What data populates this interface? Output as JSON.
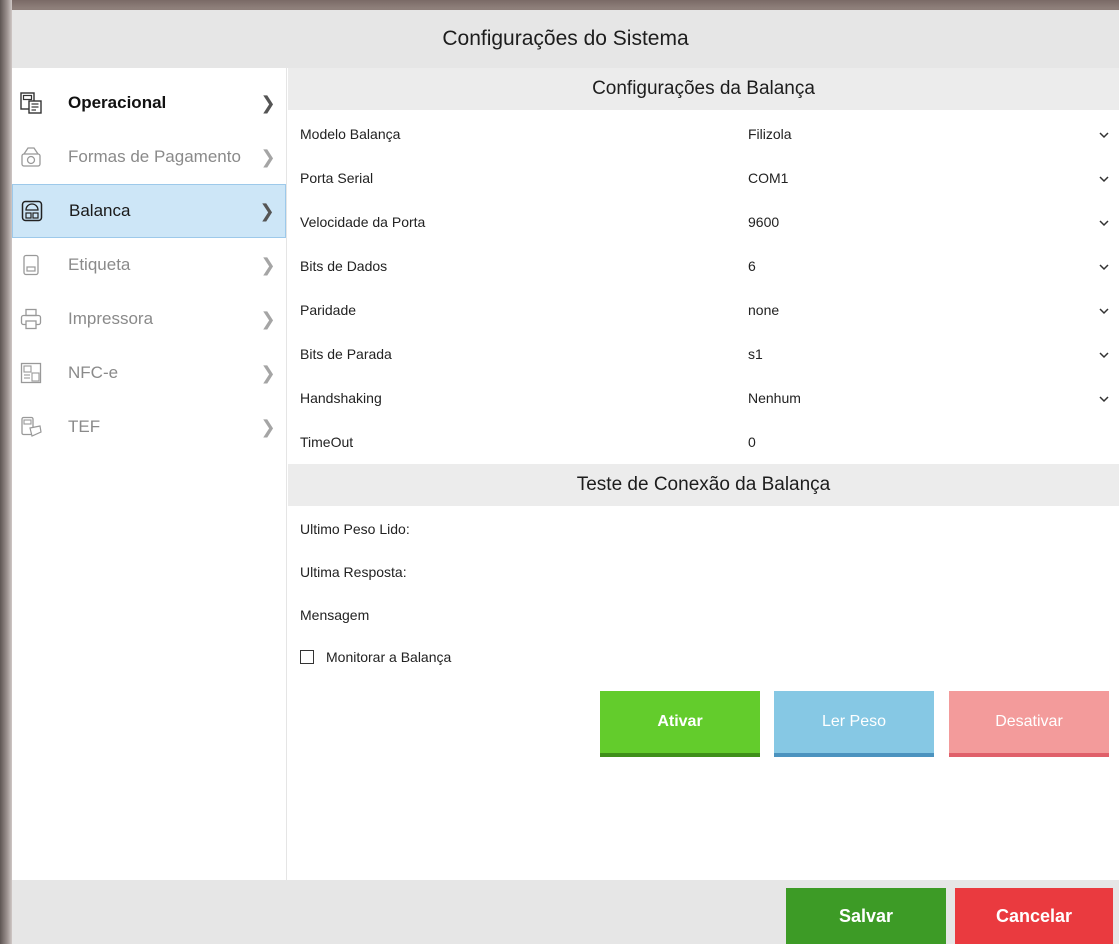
{
  "window": {
    "title": "Configurações do Sistema"
  },
  "sidebar": {
    "items": [
      {
        "label": "Operacional",
        "icon": "operational-icon",
        "state": "enabled"
      },
      {
        "label": "Formas de Pagamento",
        "icon": "payment-icon",
        "state": "disabled"
      },
      {
        "label": "Balanca",
        "icon": "scale-icon",
        "state": "selected"
      },
      {
        "label": "Etiqueta",
        "icon": "label-printer-icon",
        "state": "disabled"
      },
      {
        "label": "Impressora",
        "icon": "printer-icon",
        "state": "disabled"
      },
      {
        "label": "NFC-e",
        "icon": "nfce-icon",
        "state": "disabled"
      },
      {
        "label": "TEF",
        "icon": "tef-icon",
        "state": "disabled"
      }
    ]
  },
  "scale_settings": {
    "header": "Configurações da Balança",
    "fields": [
      {
        "label": "Modelo Balança",
        "value": "Filizola",
        "dropdown": true
      },
      {
        "label": "Porta Serial",
        "value": "COM1",
        "dropdown": true
      },
      {
        "label": "Velocidade da Porta",
        "value": "9600",
        "dropdown": true
      },
      {
        "label": "Bits de Dados",
        "value": "6",
        "dropdown": true
      },
      {
        "label": "Paridade",
        "value": "none",
        "dropdown": true
      },
      {
        "label": "Bits de Parada",
        "value": "s1",
        "dropdown": true
      },
      {
        "label": "Handshaking",
        "value": "Nenhum",
        "dropdown": true
      },
      {
        "label": "TimeOut",
        "value": "0",
        "dropdown": false
      }
    ]
  },
  "connection_test": {
    "header": "Teste de Conexão da Balança",
    "last_weight_label": "Ultimo Peso Lido:",
    "last_response_label": "Ultima Resposta:",
    "message_label": "Mensagem",
    "monitor_label": "Monitorar a Balança",
    "monitor_checked": false,
    "activate_label": "Ativar",
    "read_weight_label": "Ler Peso",
    "deactivate_label": "Desativar"
  },
  "footer": {
    "save_label": "Salvar",
    "cancel_label": "Cancelar"
  },
  "colors": {
    "selected_bg": "#cde6f7",
    "activate": "#63cc2c",
    "read_weight": "#86c8e4",
    "deactivate": "#f39b9b",
    "save": "#3d9b26",
    "cancel": "#ea3a3f"
  }
}
